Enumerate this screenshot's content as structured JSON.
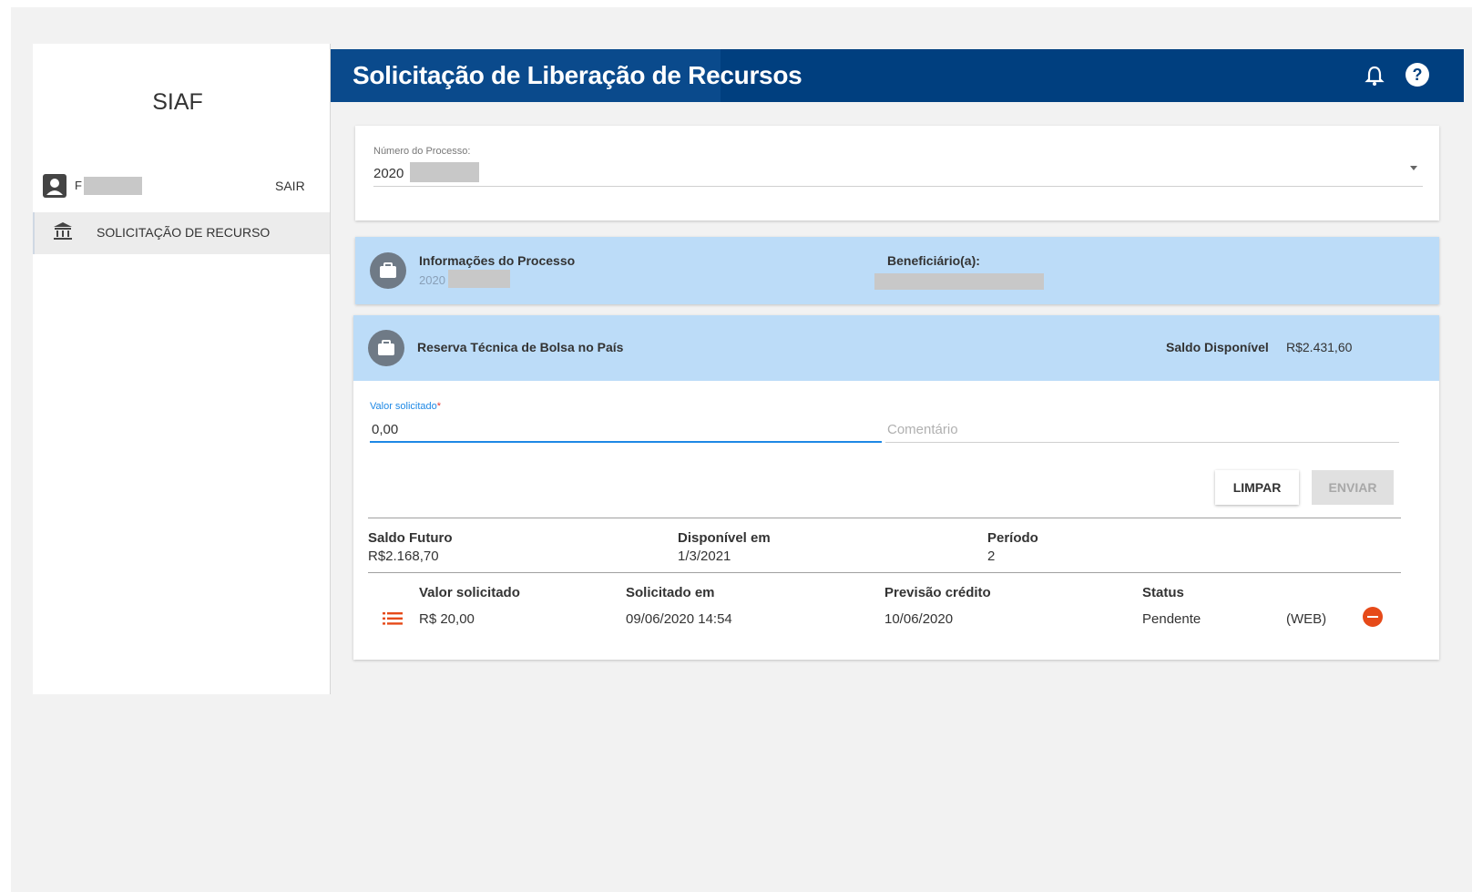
{
  "app": {
    "title": "SIAF"
  },
  "user": {
    "name_initial": "F",
    "logout_label": "SAIR"
  },
  "nav": {
    "items": [
      {
        "label": "SOLICITAÇÃO DE RECURSO",
        "icon": "bank-icon"
      }
    ]
  },
  "header": {
    "title": "Solicitação de Liberação de Recursos",
    "icons": [
      "bell-icon",
      "help-icon"
    ]
  },
  "process": {
    "label": "Número do Processo:",
    "value": "2020"
  },
  "info": {
    "heading": "Informações do Processo",
    "process_number": "2020",
    "beneficiary_label": "Beneficiário(a):"
  },
  "reserve": {
    "title": "Reserva Técnica de Bolsa no País",
    "saldo_label": "Saldo Disponível",
    "saldo_value": "R$2.431,60"
  },
  "form": {
    "valor_label": "Valor solicitado",
    "required_mark": "*",
    "valor_value": "0,00",
    "comment_placeholder": "Comentário"
  },
  "buttons": {
    "clear": "LIMPAR",
    "send": "ENVIAR"
  },
  "summary": {
    "saldo_futuro_label": "Saldo Futuro",
    "saldo_futuro_value": "R$2.168,70",
    "disponivel_label": "Disponível em",
    "disponivel_value": "1/3/2021",
    "periodo_label": "Período",
    "periodo_value": "2"
  },
  "table": {
    "headers": [
      "Valor solicitado",
      "Solicitado em",
      "Previsão crédito",
      "Status"
    ],
    "rows": [
      {
        "valor": "R$ 20,00",
        "solicitado_em": "09/06/2020 14:54",
        "previsao": "10/06/2020",
        "status": "Pendente",
        "origem": "(WEB)"
      }
    ]
  },
  "colors": {
    "header_bg": "#003f7f",
    "panel_bg": "#bcdcf8",
    "accent": "#1e88e5",
    "remove": "#e64a19",
    "list_icon": "#e64a19"
  }
}
